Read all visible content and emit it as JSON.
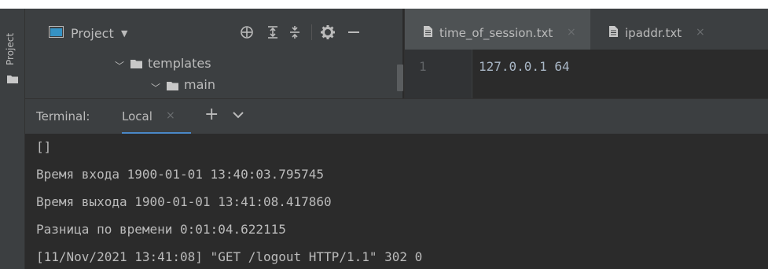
{
  "sidebar": {
    "label": "Project"
  },
  "project_panel": {
    "title": "Project",
    "tree": [
      {
        "label": "templates",
        "expanded": true
      },
      {
        "label": "main",
        "expanded": true
      }
    ],
    "tools": [
      "crosshair-icon",
      "expand-all-icon",
      "collapse-all-icon",
      "gear-icon",
      "minimize-icon"
    ]
  },
  "editor": {
    "tabs": [
      {
        "label": "time_of_session.txt",
        "active": true
      },
      {
        "label": "ipaddr.txt",
        "active": false
      }
    ],
    "close_glyph": "×",
    "line_number": "1",
    "line_text": "127.0.0.1 64"
  },
  "terminal": {
    "title": "Terminal:",
    "tab_label": "Local",
    "close_glyph": "×",
    "plus_glyph": "+",
    "lines": [
      "[]",
      "Время входа 1900-01-01 13:40:03.795745",
      "Время выхода 1900-01-01 13:41:08.417860",
      "Разница по времени 0:01:04.622115",
      "[11/Nov/2021 13:41:08] \"GET /logout HTTP/1.1\" 302 0"
    ]
  },
  "colors": {
    "accent": "#4a88c7",
    "panel_bg": "#3c3f41",
    "editor_bg": "#2b2b2b",
    "text": "#bbbbbb"
  }
}
